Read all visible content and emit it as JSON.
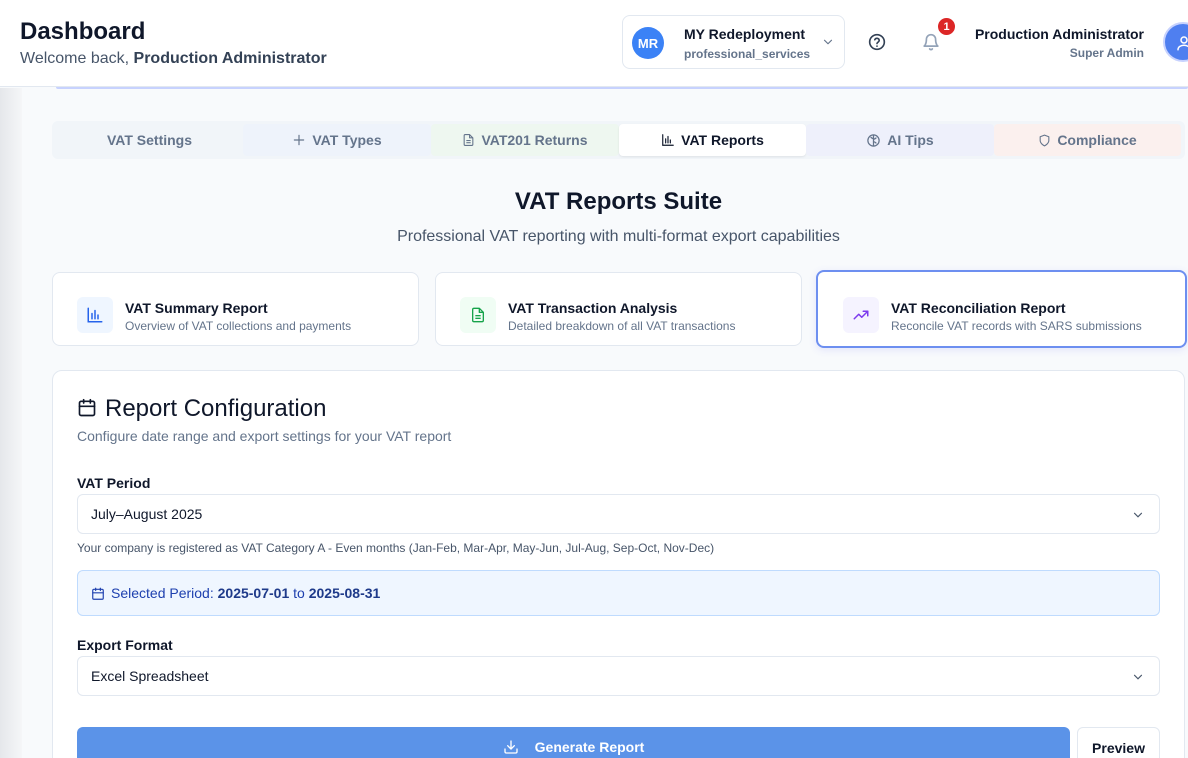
{
  "header": {
    "title": "Dashboard",
    "welcome_prefix": "Welcome back, ",
    "welcome_name": "Production Administrator",
    "org": {
      "initials": "MR",
      "name": "MY Redeployment",
      "type": "professional_services"
    },
    "notifications_count": "1",
    "user": {
      "name": "Production Administrator",
      "role": "Super Admin"
    }
  },
  "tabs": [
    {
      "label": "VAT Settings",
      "icon": "none",
      "tint": "#f1f5f9"
    },
    {
      "label": "VAT Types",
      "icon": "plus-icon",
      "tint": "#eef3fb"
    },
    {
      "label": "VAT201 Returns",
      "icon": "file-text-icon",
      "tint": "#eef7f0"
    },
    {
      "label": "VAT Reports",
      "icon": "bar-chart-icon",
      "tint": "#ffffff",
      "active": true
    },
    {
      "label": "AI Tips",
      "icon": "brain-icon",
      "tint": "#eef0fb"
    },
    {
      "label": "Compliance",
      "icon": "shield-icon",
      "tint": "#fbf0ee"
    }
  ],
  "suite": {
    "title": "VAT Reports Suite",
    "subtitle": "Professional VAT reporting with multi-format export capabilities"
  },
  "report_cards": [
    {
      "title": "VAT Summary Report",
      "description": "Overview of VAT collections and payments",
      "icon": "bar-chart-icon",
      "icon_bg": "#eff6ff",
      "icon_color": "#2563eb"
    },
    {
      "title": "VAT Transaction Analysis",
      "description": "Detailed breakdown of all VAT transactions",
      "icon": "file-text-icon",
      "icon_bg": "#f0fdf4",
      "icon_color": "#16a34a"
    },
    {
      "title": "VAT Reconciliation Report",
      "description": "Reconcile VAT records with SARS submissions",
      "icon": "trending-up-icon",
      "icon_bg": "#f5f3ff",
      "icon_color": "#7c3aed",
      "selected": true
    }
  ],
  "config": {
    "title": "Report Configuration",
    "subtitle": "Configure date range and export settings for your VAT report",
    "vat_period_label": "VAT Period",
    "vat_period_value": "July–August 2025",
    "hint": "Your company is registered as VAT Category A - Even months (Jan-Feb, Mar-Apr, May-Jun, Jul-Aug, Sep-Oct, Nov-Dec)",
    "selected_period_label": "Selected Period: ",
    "period_start": "2025-07-01",
    "period_to": " to ",
    "period_end": "2025-08-31",
    "export_format_label": "Export Format",
    "export_format_value": "Excel Spreadsheet",
    "generate_label": "Generate Report",
    "preview_label": "Preview"
  },
  "colors": {
    "primary_button": "#5b93e8",
    "accent": "#3b82f6",
    "badge": "#dc2626"
  }
}
